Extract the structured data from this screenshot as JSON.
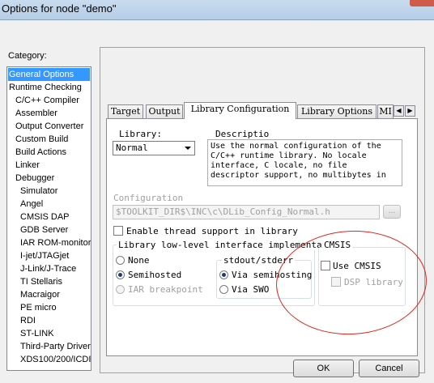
{
  "window": {
    "title": "Options for node \"demo\""
  },
  "category": {
    "label": "Category:",
    "items": [
      {
        "label": "General Options",
        "selected": true,
        "indent": 0
      },
      {
        "label": "Runtime Checking",
        "indent": 0
      },
      {
        "label": "C/C++ Compiler",
        "indent": 1
      },
      {
        "label": "Assembler",
        "indent": 1
      },
      {
        "label": "Output Converter",
        "indent": 1
      },
      {
        "label": "Custom Build",
        "indent": 1
      },
      {
        "label": "Build Actions",
        "indent": 1
      },
      {
        "label": "Linker",
        "indent": 1
      },
      {
        "label": "Debugger",
        "indent": 1
      },
      {
        "label": "Simulator",
        "indent": 2
      },
      {
        "label": "Angel",
        "indent": 2
      },
      {
        "label": "CMSIS DAP",
        "indent": 2
      },
      {
        "label": "GDB Server",
        "indent": 2
      },
      {
        "label": "IAR ROM-monitor",
        "indent": 2
      },
      {
        "label": "I-jet/JTAGjet",
        "indent": 2
      },
      {
        "label": "J-Link/J-Trace",
        "indent": 2
      },
      {
        "label": "TI Stellaris",
        "indent": 2
      },
      {
        "label": "Macraigor",
        "indent": 2
      },
      {
        "label": "PE micro",
        "indent": 2
      },
      {
        "label": "RDI",
        "indent": 2
      },
      {
        "label": "ST-LINK",
        "indent": 2
      },
      {
        "label": "Third-Party Driver",
        "indent": 2
      },
      {
        "label": "XDS100/200/ICDI",
        "indent": 2
      }
    ]
  },
  "tabs": [
    {
      "label": "Target"
    },
    {
      "label": "Output"
    },
    {
      "label": "Library Configuration",
      "active": true
    },
    {
      "label": "Library Options"
    },
    {
      "label": "MI"
    }
  ],
  "library": {
    "label": "Library:",
    "value": "Normal",
    "description_label": "Descriptio",
    "description": "Use the normal configuration of the C/C++ runtime library. No locale interface, C locale, no file descriptor support, no multibytes in"
  },
  "configuration": {
    "label": "Configuration",
    "path": "$TOOLKIT_DIR$\\INC\\c\\DLib_Config_Normal.h",
    "browse_label": "..."
  },
  "thread_support": {
    "label": "Enable thread support in library",
    "checked": false
  },
  "low_level": {
    "title": "Library low-level interface implementation",
    "options": [
      {
        "label": "None",
        "selected": false
      },
      {
        "label": "Semihosted",
        "selected": true
      },
      {
        "label": "IAR breakpoint",
        "selected": false,
        "disabled": true
      }
    ],
    "stdout": {
      "title": "stdout/stderr",
      "options": [
        {
          "label": "Via semihosting",
          "selected": true
        },
        {
          "label": "Via SWO",
          "selected": false
        }
      ]
    }
  },
  "cmsis": {
    "title": "CMSIS",
    "use_label": "Use CMSIS",
    "use_checked": false,
    "dsp_label": "DSP library",
    "dsp_checked": false
  },
  "buttons": {
    "ok": "OK",
    "cancel": "Cancel"
  },
  "colors": {
    "selection": "#3399ff",
    "annotation": "#e3241c",
    "title_bar": "#b9d1ea"
  }
}
